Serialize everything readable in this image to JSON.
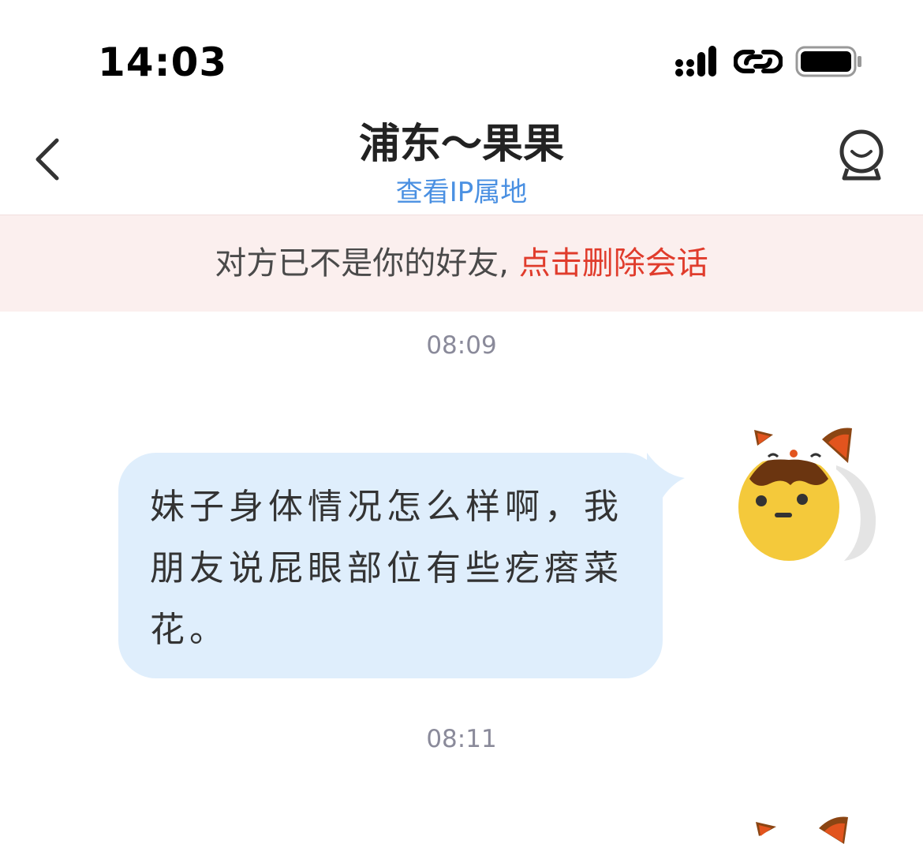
{
  "status_bar": {
    "time": "14:03",
    "icons": [
      "signal-icon",
      "link-icon",
      "battery-icon"
    ]
  },
  "nav": {
    "back_icon": "chevron-left-icon",
    "title": "浦东～果果",
    "subtitle": "查看IP属地",
    "profile_icon": "profile-icon"
  },
  "banner": {
    "text": "对方已不是你的好友,",
    "action": " 点击删除会话"
  },
  "messages": [
    {
      "time": "08:09",
      "text": "妹子身体情况怎么样啊，我朋友说屁眼部位有些疙瘩菜花。",
      "avatar": "lucky-cat-avatar"
    },
    {
      "time": "08:11",
      "avatar": "lucky-cat-avatar"
    }
  ],
  "colors": {
    "accent_blue": "#4a90e2",
    "warning_red": "#e03c2c",
    "bubble_bg": "#dfeefc",
    "banner_bg": "#fbefee"
  }
}
